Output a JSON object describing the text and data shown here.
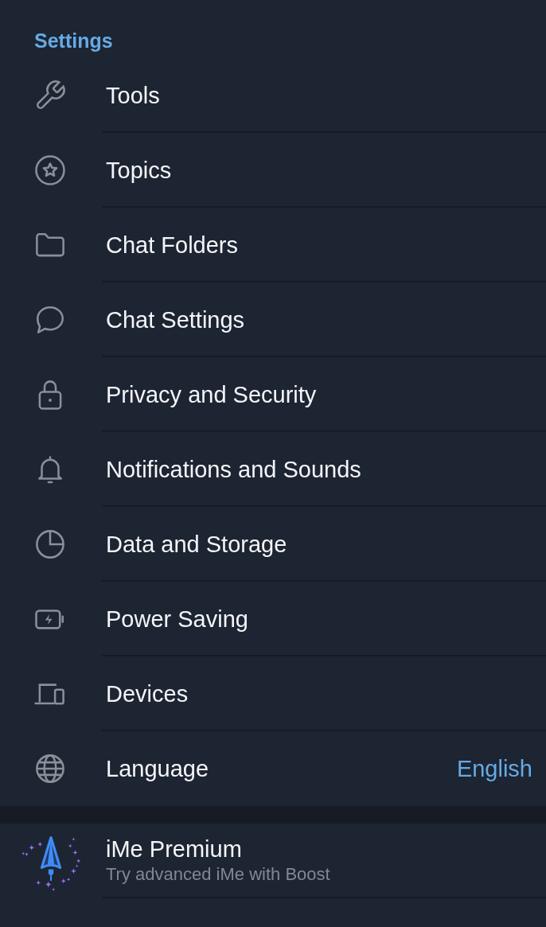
{
  "header": {
    "title": "Settings"
  },
  "items": [
    {
      "label": "Tools"
    },
    {
      "label": "Topics"
    },
    {
      "label": "Chat Folders"
    },
    {
      "label": "Chat Settings"
    },
    {
      "label": "Privacy and Security"
    },
    {
      "label": "Notifications and Sounds"
    },
    {
      "label": "Data and Storage"
    },
    {
      "label": "Power Saving"
    },
    {
      "label": "Devices"
    },
    {
      "label": "Language",
      "value": "English"
    }
  ],
  "premium": {
    "title": "iMe Premium",
    "subtitle": "Try advanced iMe with Boost"
  }
}
